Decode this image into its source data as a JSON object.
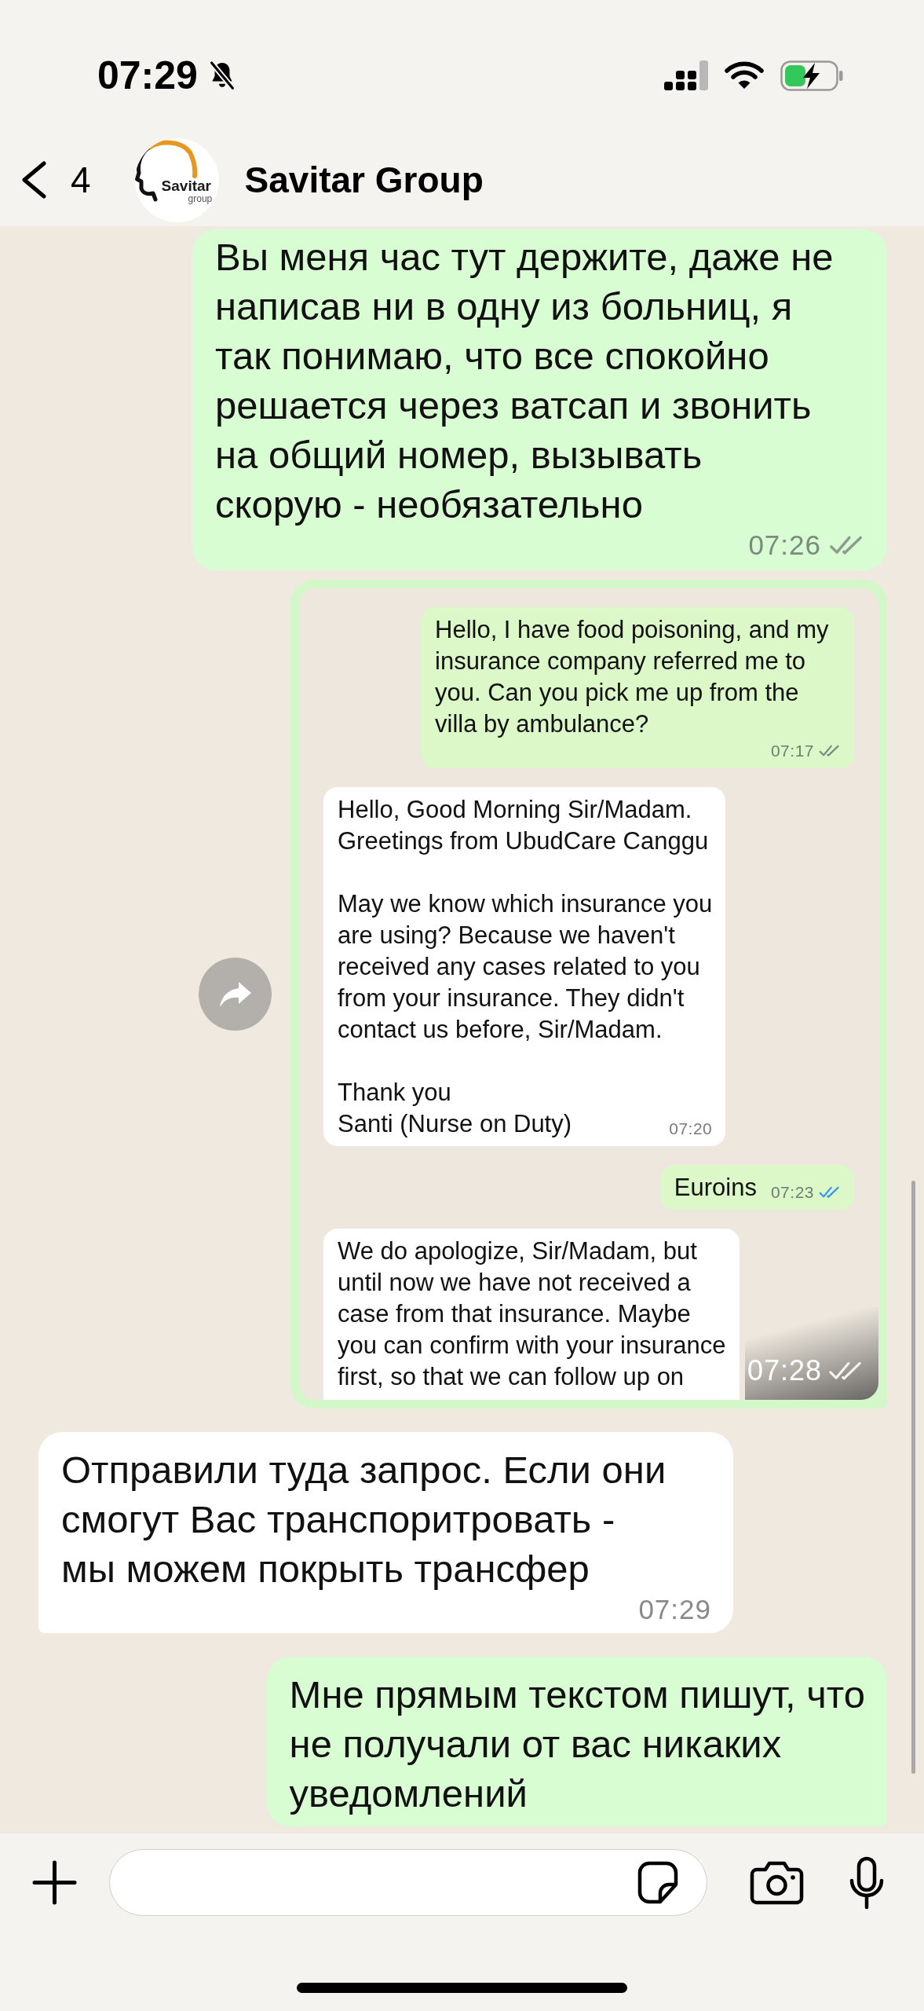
{
  "status_bar": {
    "time": "07:29",
    "silent": true
  },
  "header": {
    "back_count": "4",
    "avatar": {
      "wordmark": "Savitar",
      "subtext": "group"
    },
    "title": "Savitar Group"
  },
  "messages": [
    {
      "kind": "text",
      "outgoing": true,
      "paragraphs": [
        "Вы меня час тут держите, даже не\nнаписав ни в одну из больниц, я\nтак понимаю, что все спокойно\nрешается через ватсап и звонить\nна общий номер, вызывать\nскорую - необязательно"
      ],
      "time": "07:26",
      "read": false
    },
    {
      "kind": "image",
      "outgoing": true,
      "time": "07:28",
      "read": false,
      "forward_button": true,
      "screenshot": {
        "messages": [
          {
            "outgoing": true,
            "paragraphs": [
              "Hello, I have food poisoning, and my\ninsurance company referred me to\nyou. Can you pick me up from the\nvilla by ambulance?"
            ],
            "time": "07:17",
            "read": false
          },
          {
            "outgoing": false,
            "paragraphs": [
              "Hello, Good Morning Sir/Madam.\nGreetings from UbudCare Canggu",
              "May we know which insurance you\nare using? Because we haven't\nreceived any cases related to you\nfrom your insurance. They didn't\ncontact us before, Sir/Madam.",
              "Thank you\nSanti (Nurse on Duty)"
            ],
            "time": "07:20"
          },
          {
            "outgoing": true,
            "paragraphs": [
              "Euroins"
            ],
            "time": "07:23",
            "read": true
          },
          {
            "outgoing": false,
            "paragraphs": [
              "We do apologize, Sir/Madam, but\nuntil now we have not received a\ncase from that insurance. Maybe\nyou can confirm with your insurance\nfirst, so that we can follow up on"
            ]
          }
        ]
      }
    },
    {
      "kind": "text",
      "outgoing": false,
      "paragraphs": [
        "Отправили туда запрос. Если они\nсмогут Вас транспоритровать -\nмы можем покрыть трансфер"
      ],
      "time": "07:29"
    },
    {
      "kind": "text",
      "outgoing": true,
      "paragraphs": [
        "Мне прямым текстом пишут, что\nне получали от вас никаких\nуведомлений"
      ]
    }
  ]
}
